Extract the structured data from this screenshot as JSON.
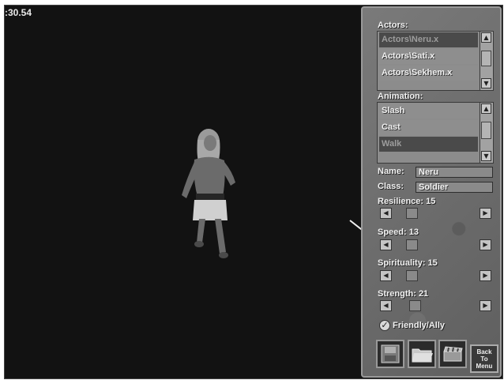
{
  "fps_counter": ":30.54",
  "actors": {
    "label": "Actors:",
    "items": [
      "Actors\\Neru.x",
      "Actors\\Sati.x",
      "Actors\\Sekhem.x"
    ]
  },
  "animation": {
    "label": "Animation:",
    "items": [
      "Slash",
      "Cast",
      "Walk"
    ]
  },
  "name": {
    "label": "Name:",
    "value": "Neru"
  },
  "class": {
    "label": "Class:",
    "value": "Soldier"
  },
  "stats": {
    "resilience": "Resilience: 15",
    "speed": "Speed: 13",
    "spirituality": "Spirituality: 15",
    "strength": "Strength: 21"
  },
  "friendly": {
    "label": "Friendly/Ally",
    "checked": true
  },
  "toolbar": {
    "back_line1": "Back",
    "back_line2": "To",
    "back_line3": "Menu"
  },
  "icons": {
    "save": "save-icon",
    "open": "folder-icon",
    "clapper": "clapperboard-icon"
  }
}
